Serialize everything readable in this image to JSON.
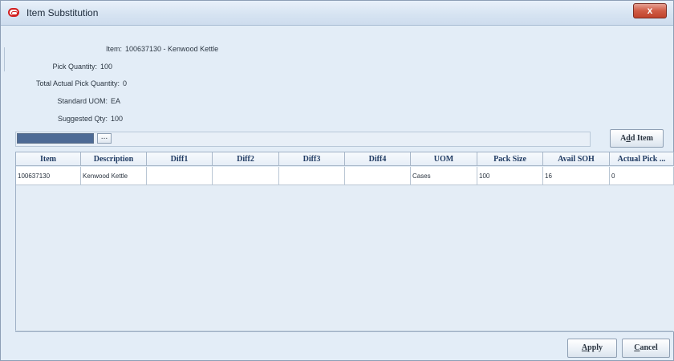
{
  "window": {
    "title": "Item Substitution",
    "close_label": "x"
  },
  "info": {
    "item": {
      "label": "Item:",
      "value": "100637130 - Kenwood Kettle"
    },
    "pick_qty": {
      "label": "Pick Quantity:",
      "value": "100"
    },
    "total_actual": {
      "label": "Total Actual Pick Quantity:",
      "value": "0"
    },
    "uom": {
      "label": "Standard UOM:",
      "value": "EA"
    },
    "suggested": {
      "label": "Suggested Qty:",
      "value": "100"
    }
  },
  "toolbar": {
    "search_value": "",
    "browse_label": "...",
    "add_item_prefix": "A",
    "add_item_mnemonic": "d",
    "add_item_rest": "d Item"
  },
  "table": {
    "columns": [
      "Item",
      "Description",
      "Diff1",
      "Diff2",
      "Diff3",
      "Diff4",
      "UOM",
      "Pack Size",
      "Avail SOH",
      "Actual Pick ..."
    ],
    "rows": [
      [
        "100637130",
        "Kenwood Kettle",
        "",
        "",
        "",
        "",
        "Cases",
        "100",
        "16",
        "0"
      ]
    ]
  },
  "footer": {
    "apply_mnemonic": "A",
    "apply_rest": "pply",
    "cancel_mnemonic": "C",
    "cancel_rest": "ancel"
  }
}
